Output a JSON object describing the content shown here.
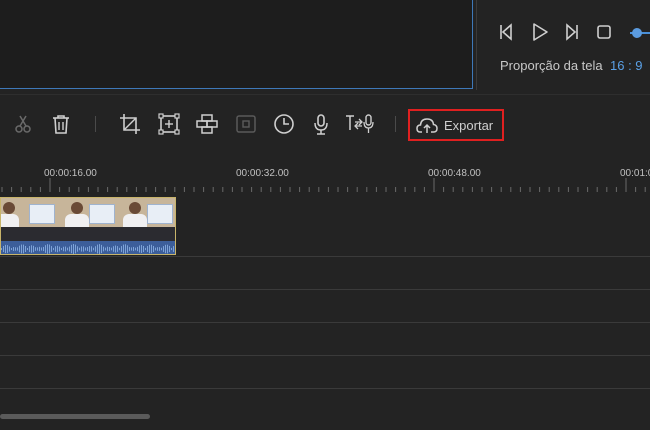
{
  "player": {
    "aspect_label": "Proporção da tela",
    "aspect_value": "16 : 9",
    "controls": [
      "prev-frame-icon",
      "play-icon",
      "next-frame-icon",
      "stop-icon"
    ]
  },
  "toolbar": {
    "tools": [
      "cut-icon",
      "delete-icon",
      "crop-icon",
      "resize-icon",
      "mosaic-icon",
      "freeze-frame-icon",
      "speed-icon",
      "record-voice-icon",
      "text-to-speech-icon"
    ],
    "export_label": "Exportar",
    "export_icon": "cloud-upload-icon"
  },
  "timeline": {
    "ticks": [
      "00:00:16.00",
      "00:00:32.00",
      "00:00:48.00",
      "00:01:0"
    ]
  },
  "colors": {
    "accent": "#5aa0e6",
    "highlight_border": "#e02020",
    "clip_border": "#c8b46a"
  }
}
